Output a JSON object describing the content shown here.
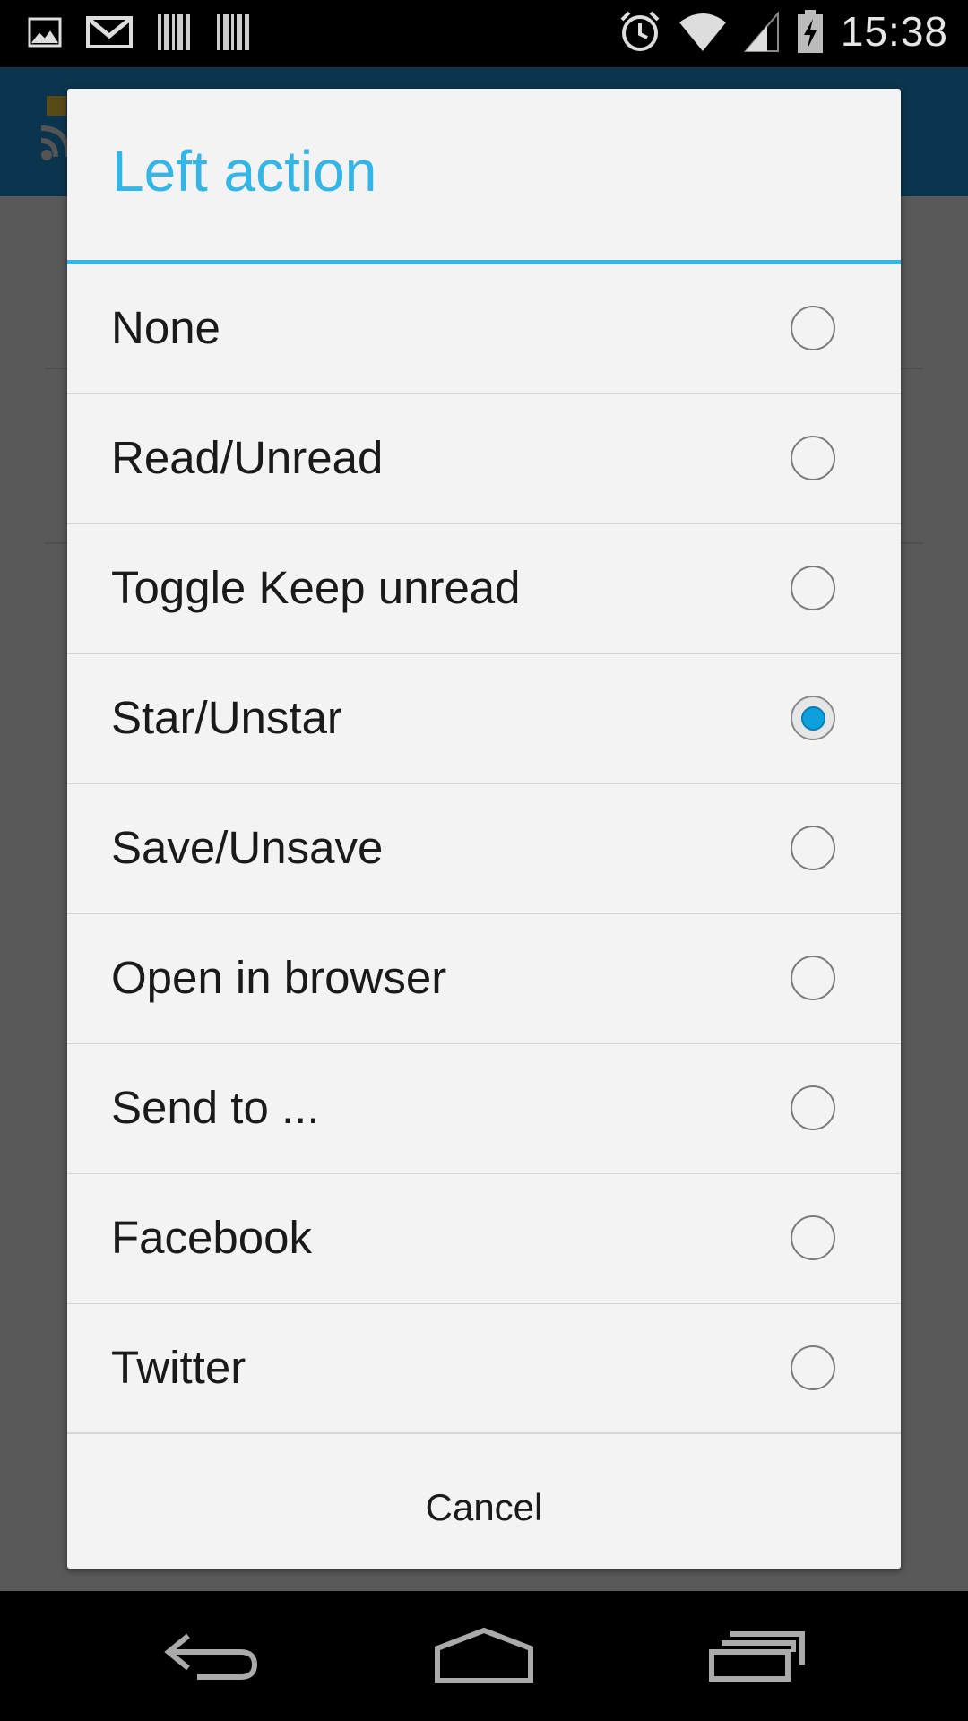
{
  "status_bar": {
    "time": "15:38",
    "left_icons": [
      "gallery-icon",
      "gmail-icon",
      "barcode-icon",
      "barcode-icon"
    ],
    "right_icons": [
      "alarm-icon",
      "wifi-icon",
      "signal-icon",
      "battery-charging-icon"
    ]
  },
  "dialog": {
    "title": "Left action",
    "options": [
      {
        "label": "None",
        "selected": false
      },
      {
        "label": "Read/Unread",
        "selected": false
      },
      {
        "label": "Toggle Keep unread",
        "selected": false
      },
      {
        "label": "Star/Unstar",
        "selected": true
      },
      {
        "label": "Save/Unsave",
        "selected": false
      },
      {
        "label": "Open in browser",
        "selected": false
      },
      {
        "label": "Send to ...",
        "selected": false
      },
      {
        "label": "Facebook",
        "selected": false
      },
      {
        "label": "Twitter",
        "selected": false
      }
    ],
    "cancel_label": "Cancel"
  },
  "nav_bar": {
    "buttons": [
      "back-icon",
      "home-icon",
      "recents-icon"
    ]
  },
  "colors": {
    "accent": "#33b5e5",
    "radio_selected": "#0e9fde",
    "dialog_bg": "#f3f3f3",
    "action_bar": "#1f8ccd"
  }
}
